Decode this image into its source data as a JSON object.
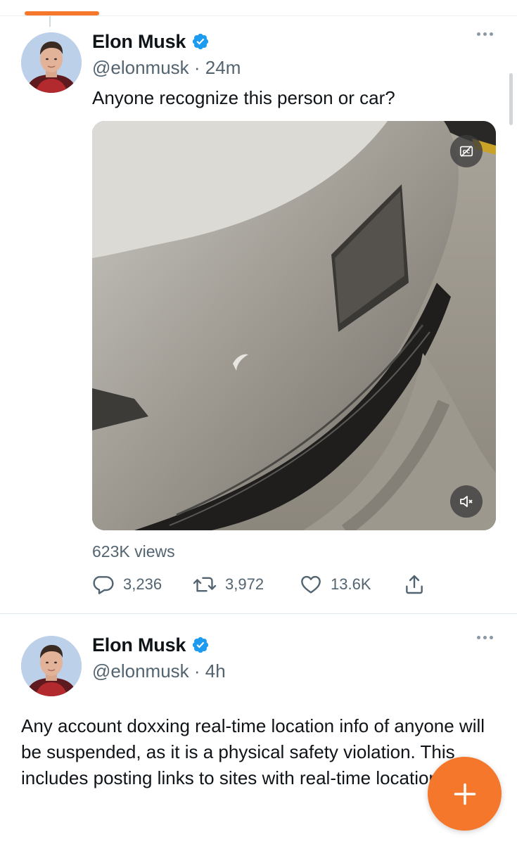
{
  "colors": {
    "accent": "#f4772b",
    "verified": "#1d9bf0",
    "text_primary": "#0f1419",
    "text_secondary": "#536471"
  },
  "tweets": [
    {
      "author_name": "Elon Musk",
      "verified_icon": "verified-badge-icon",
      "handle_time": "@elonmusk · 24m",
      "text": "Anyone recognize this person or car?",
      "media": {
        "type": "video",
        "captions_icon": "captions-off-icon",
        "mute_icon": "speaker-muted-icon"
      },
      "views": "623K views",
      "actions": {
        "replies": "3,236",
        "retweets": "3,972",
        "likes": "13.6K"
      }
    },
    {
      "author_name": "Elon Musk",
      "verified_icon": "verified-badge-icon",
      "handle_time": "@elonmusk · 4h",
      "text": "Any account doxxing real-time location info of anyone will be suspended, as it is a physical safety violation. This includes posting links to sites with real-time location info."
    }
  ],
  "compose_button": {
    "icon": "plus-icon"
  }
}
